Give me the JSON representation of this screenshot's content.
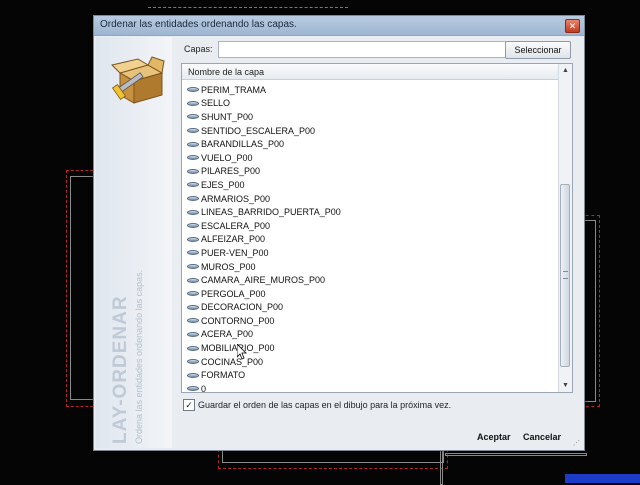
{
  "window": {
    "title": "Ordenar las entidades ordenando las capas.",
    "close_glyph": "✕"
  },
  "sidebar": {
    "big_text": "LAY-ORDENAR",
    "small_text": "Ordena las entidades ordenando las capas.",
    "logo_icon": "toolbox-icon"
  },
  "filter": {
    "label": "Capas:",
    "value": "",
    "select_button": "Seleccionar"
  },
  "list": {
    "header": "Nombre de la capa",
    "rows": [
      "PERIM_TRAMA",
      "SELLO",
      "SHUNT_P00",
      "SENTIDO_ESCALERA_P00",
      "BARANDILLAS_P00",
      "VUELO_P00",
      "PILARES_P00",
      "EJES_P00",
      "ARMARIOS_P00",
      "LINEAS_BARRIDO_PUERTA_P00",
      "ESCALERA_P00",
      "ALFEIZAR_P00",
      "PUER-VEN_P00",
      "MUROS_P00",
      "CAMARA_AIRE_MUROS_P00",
      "PERGOLA_P00",
      "DECORACION_P00",
      "CONTORNO_P00",
      "ACERA_P00",
      "MOBILIARIO_P00",
      "COCINAS_P00",
      "FORMATO",
      "0"
    ],
    "scroll_up": "▲",
    "scroll_down": "▼"
  },
  "options": {
    "save_order_label": "Guardar el orden de las capas en el dibujo para la próxima vez.",
    "save_order_checked": true,
    "check_glyph": "✓"
  },
  "footer": {
    "accept": "Aceptar",
    "cancel": "Cancelar"
  },
  "colors": {
    "cad_red": "#b0282a",
    "cad_blue": "#1c3cc8",
    "title_bar": "#a9bfd9"
  }
}
